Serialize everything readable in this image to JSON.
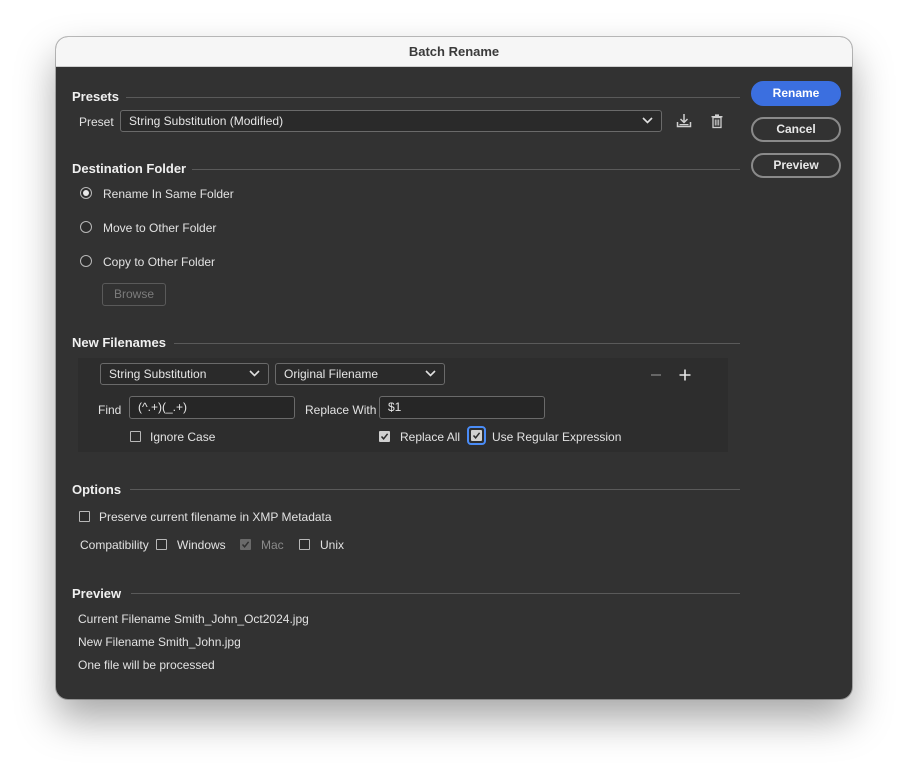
{
  "window": {
    "title": "Batch Rename"
  },
  "presets": {
    "section_title": "Presets",
    "preset_label": "Preset",
    "preset_value": "String Substitution (Modified)"
  },
  "destination": {
    "section_title": "Destination Folder",
    "options": [
      {
        "label": "Rename In Same Folder",
        "selected": true
      },
      {
        "label": "Move to Other Folder",
        "selected": false
      },
      {
        "label": "Copy to Other Folder",
        "selected": false
      }
    ],
    "browse_label": "Browse"
  },
  "new_filenames": {
    "section_title": "New Filenames",
    "type_select": "String Substitution",
    "source_select": "Original Filename",
    "find_label": "Find",
    "find_value": "(^.+)(_.+)",
    "replace_label": "Replace With",
    "replace_value": "$1",
    "ignore_case_label": "Ignore Case",
    "ignore_case_checked": false,
    "replace_all_label": "Replace All",
    "replace_all_checked": true,
    "use_regex_label": "Use Regular Expression",
    "use_regex_checked": true
  },
  "options": {
    "section_title": "Options",
    "preserve_label": "Preserve current filename in XMP Metadata",
    "preserve_checked": false,
    "compatibility_label": "Compatibility",
    "windows_label": "Windows",
    "windows_checked": false,
    "mac_label": "Mac",
    "mac_checked": true,
    "unix_label": "Unix",
    "unix_checked": false
  },
  "preview": {
    "section_title": "Preview",
    "current_filename": "Current Filename Smith_John_Oct2024.jpg",
    "new_filename": "New Filename Smith_John.jpg",
    "file_count": "One file will be processed"
  },
  "buttons": {
    "rename": "Rename",
    "cancel": "Cancel",
    "preview": "Preview"
  },
  "icons": {
    "save_preset": "save-icon",
    "delete_preset": "trash-icon",
    "remove_row": "minus-icon",
    "add_row": "plus-icon"
  },
  "colors": {
    "primary_button": "#3b6fe0",
    "focus_ring": "#4a8cf7",
    "dialog_bg": "#323232"
  }
}
